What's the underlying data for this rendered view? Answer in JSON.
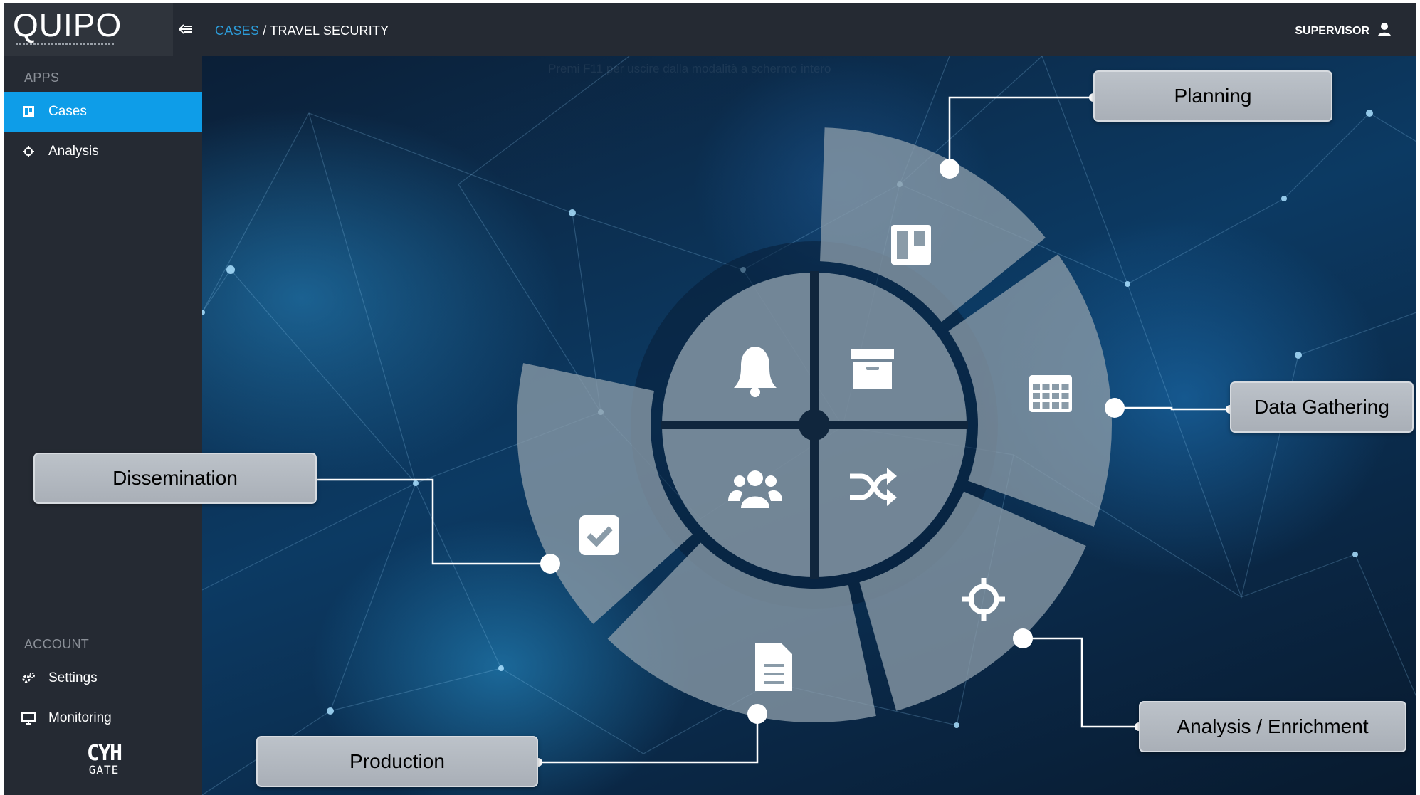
{
  "app": {
    "logo_text": "QUIPO",
    "collapse_icon": "collapse-sidebar-icon"
  },
  "breadcrumb": {
    "link": "CASES",
    "separator": "/",
    "current": "TRAVEL SECURITY"
  },
  "user": {
    "role": "SUPERVISOR",
    "icon": "user-icon"
  },
  "sidebar": {
    "apps_title": "APPS",
    "apps": [
      {
        "label": "Cases",
        "icon": "board-icon",
        "active": true
      },
      {
        "label": "Analysis",
        "icon": "crosshair-icon",
        "active": false
      }
    ],
    "account_title": "ACCOUNT",
    "account": [
      {
        "label": "Settings",
        "icon": "gears-icon"
      },
      {
        "label": "Monitoring",
        "icon": "monitor-icon"
      }
    ],
    "footer_logo": {
      "top": "CYH",
      "bottom": "GATE"
    }
  },
  "overlay": {
    "fullscreen_hint": "Premi F11 per uscire dalla modalità a schermo intero"
  },
  "wheel": {
    "outer_segments": [
      {
        "name": "Planning",
        "icon": "board-icon"
      },
      {
        "name": "Data Gathering",
        "icon": "table-icon"
      },
      {
        "name": "Analysis / Enrichment",
        "icon": "crosshair-icon"
      },
      {
        "name": "Production",
        "icon": "document-icon"
      },
      {
        "name": "Dissemination",
        "icon": "check-square-icon"
      }
    ],
    "inner_quadrants": [
      {
        "icon": "bell-icon"
      },
      {
        "icon": "archive-icon"
      },
      {
        "icon": "users-icon"
      },
      {
        "icon": "shuffle-icon"
      }
    ]
  },
  "callouts": {
    "planning": "Planning",
    "data_gathering": "Data Gathering",
    "analysis": "Analysis / Enrichment",
    "production": "Production",
    "dissemination": "Dissemination"
  },
  "colors": {
    "accent": "#0e9de8",
    "link": "#2c9bd8",
    "sidebar": "#252a33",
    "segment": "#7a8a95"
  }
}
